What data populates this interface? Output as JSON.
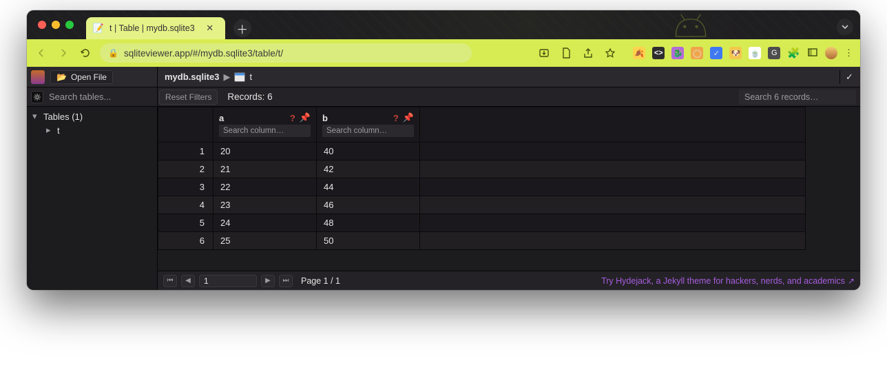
{
  "browser": {
    "tab_title": "t | Table | mydb.sqlite3",
    "url": "sqliteviewer.app/#/mydb.sqlite3/table/t/"
  },
  "toolbar": {
    "open_file_label": "Open File"
  },
  "breadcrumb": {
    "database": "mydb.sqlite3",
    "table": "t"
  },
  "sidebar": {
    "search_placeholder": "Search tables...",
    "tables_heading": "Tables (1)",
    "items": [
      {
        "name": "t"
      }
    ]
  },
  "filters": {
    "reset_label": "Reset Filters",
    "records_label": "Records: 6",
    "search_placeholder": "Search 6 records…"
  },
  "columns": [
    {
      "name": "a",
      "search_placeholder": "Search column…"
    },
    {
      "name": "b",
      "search_placeholder": "Search column…"
    }
  ],
  "rows": [
    {
      "n": "1",
      "a": "20",
      "b": "40"
    },
    {
      "n": "2",
      "a": "21",
      "b": "42"
    },
    {
      "n": "3",
      "a": "22",
      "b": "44"
    },
    {
      "n": "4",
      "a": "23",
      "b": "46"
    },
    {
      "n": "5",
      "a": "24",
      "b": "48"
    },
    {
      "n": "6",
      "a": "25",
      "b": "50"
    }
  ],
  "pager": {
    "current_page": "1",
    "page_info": "Page 1 / 1"
  },
  "promo": {
    "text": "Try Hydejack, a Jekyll theme for hackers, nerds, and academics"
  }
}
